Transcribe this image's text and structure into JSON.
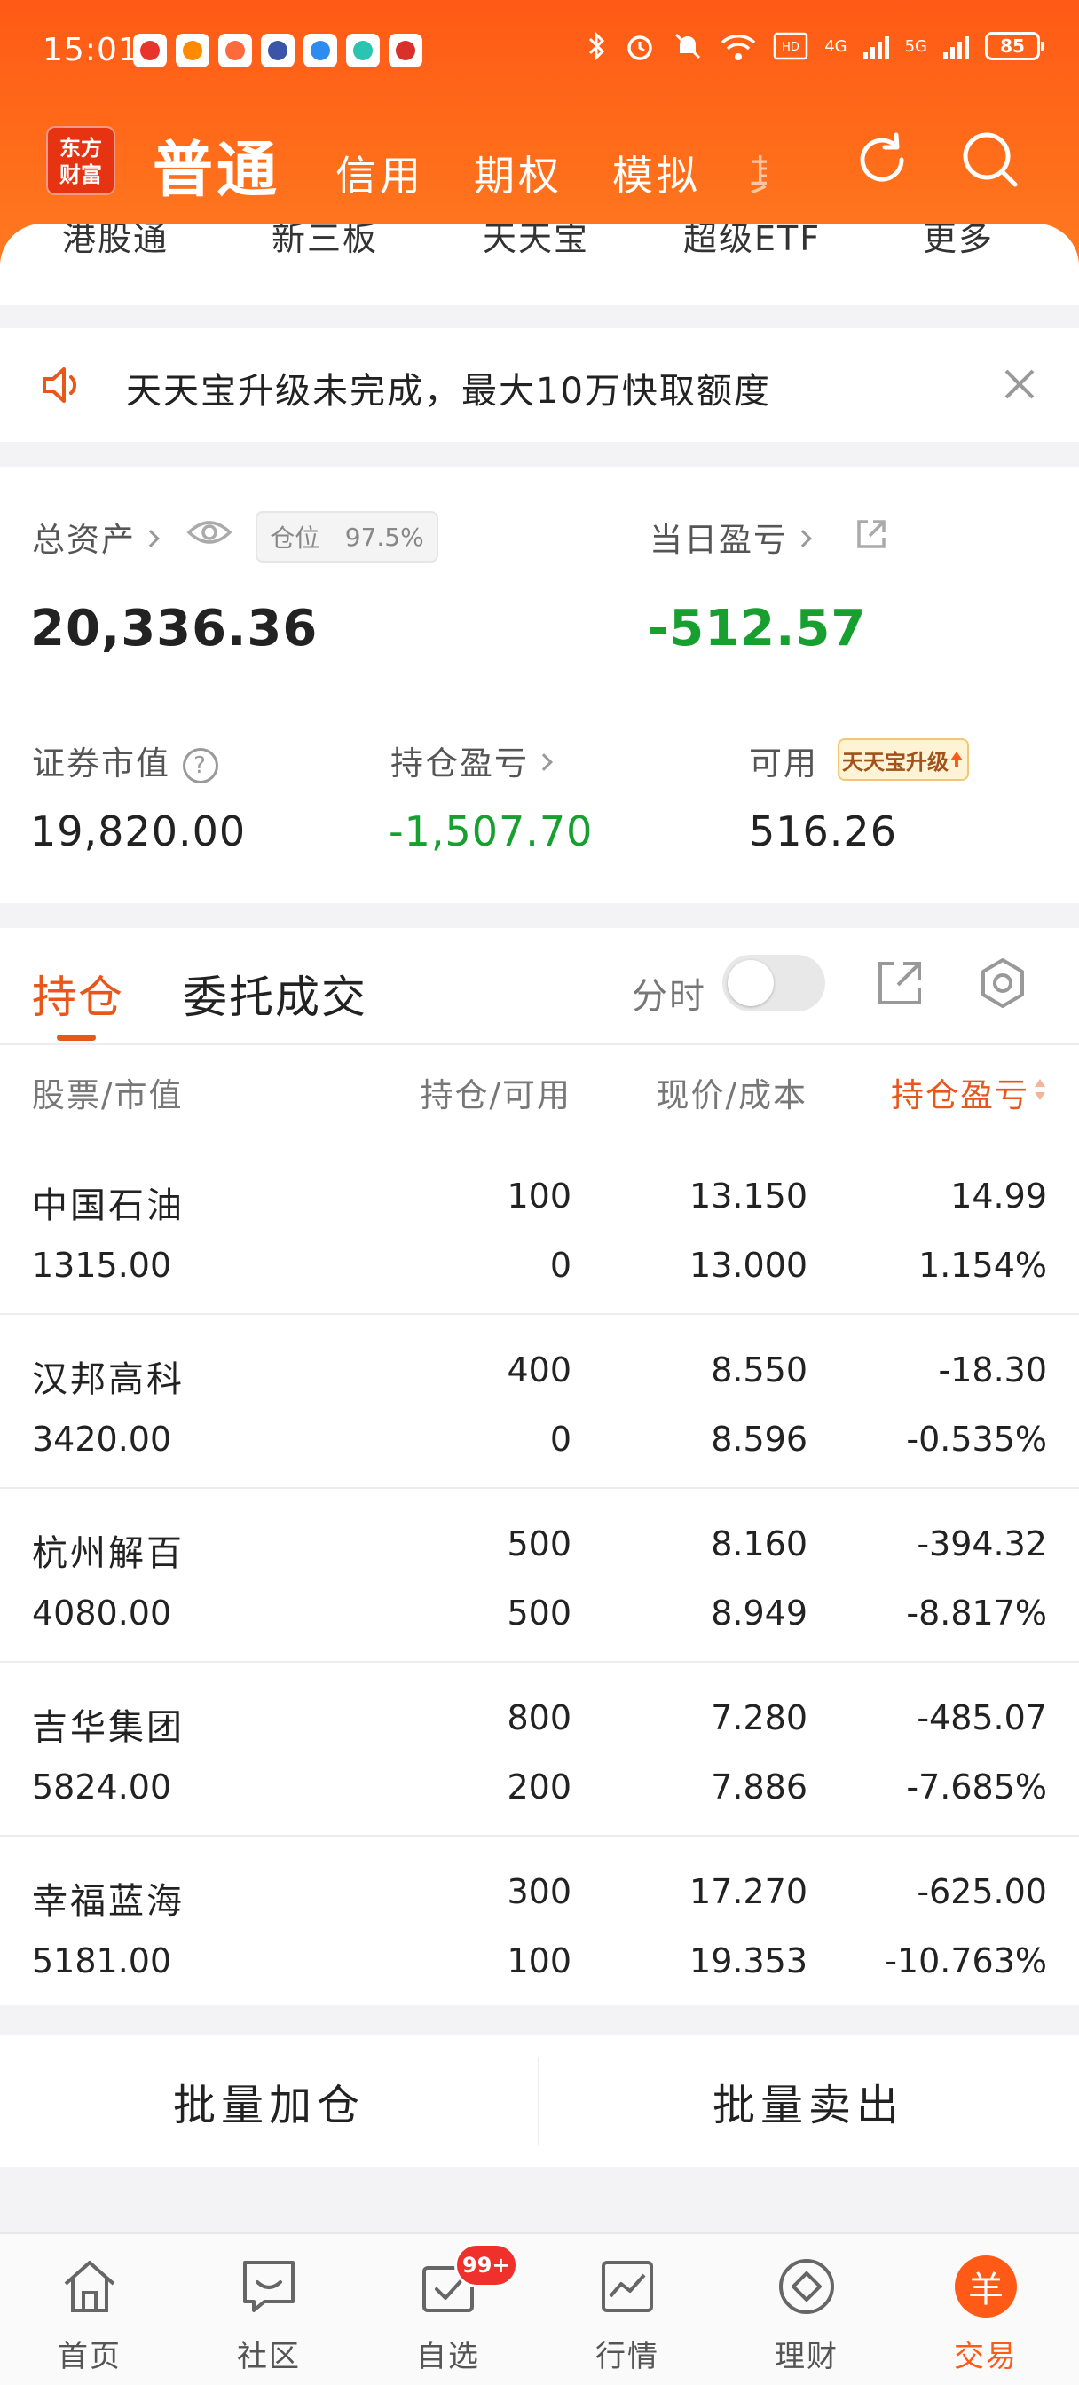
{
  "status_bar": {
    "time": "15:01",
    "net_4g": "4G",
    "net_5g": "5G",
    "battery": "85"
  },
  "header": {
    "logo_line1": "东方",
    "logo_line2": "财富",
    "tabs": [
      "普通",
      "信用",
      "期权",
      "模拟",
      "其"
    ]
  },
  "quick_entries": [
    "港股通",
    "新三板",
    "天天宝",
    "超级ETF",
    "更多"
  ],
  "notice": {
    "text": "天天宝升级未完成，最大10万快取额度"
  },
  "assets": {
    "total_label": "总资产",
    "position_label": "仓位",
    "position_value": "97.5%",
    "total_value": "20,336.36",
    "daily_pl_label": "当日盈亏",
    "daily_pl_value": "-512.57",
    "market_value_label": "证券市值",
    "market_value": "19,820.00",
    "holding_pl_label": "持仓盈亏",
    "holding_pl_value": "-1,507.70",
    "available_label": "可用",
    "available_value": "516.26",
    "upgrade_badge": "天天宝升级"
  },
  "holdings": {
    "tab_holdings": "持仓",
    "tab_orders": "委托成交",
    "timeshare_label": "分时",
    "columns": [
      "股票/市值",
      "持仓/可用",
      "现价/成本",
      "持仓盈亏"
    ],
    "rows": [
      {
        "name": "中国石油",
        "market_value": "1315.00",
        "qty": "100",
        "available": "0",
        "price": "13.150",
        "cost": "13.000",
        "pl": "14.99",
        "pl_pct": "1.154%",
        "up": true
      },
      {
        "name": "汉邦高科",
        "market_value": "3420.00",
        "qty": "400",
        "available": "0",
        "price": "8.550",
        "cost": "8.596",
        "pl": "-18.30",
        "pl_pct": "-0.535%",
        "up": false
      },
      {
        "name": "杭州解百",
        "market_value": "4080.00",
        "qty": "500",
        "available": "500",
        "price": "8.160",
        "cost": "8.949",
        "pl": "-394.32",
        "pl_pct": "-8.817%",
        "up": false
      },
      {
        "name": "吉华集团",
        "market_value": "5824.00",
        "qty": "800",
        "available": "200",
        "price": "7.280",
        "cost": "7.886",
        "pl": "-485.07",
        "pl_pct": "-7.685%",
        "up": false
      },
      {
        "name": "幸福蓝海",
        "market_value": "5181.00",
        "qty": "300",
        "available": "100",
        "price": "17.270",
        "cost": "19.353",
        "pl": "-625.00",
        "pl_pct": "-10.763%",
        "up": false
      }
    ]
  },
  "batch": {
    "add_label": "批量加仓",
    "sell_label": "批量卖出"
  },
  "bottom_nav": {
    "items": [
      "首页",
      "社区",
      "自选",
      "行情",
      "理财",
      "交易"
    ],
    "watchlist_badge": "99+",
    "trade_glyph": "羊"
  },
  "colors": {
    "brand_orange": "#ff5a16",
    "accent_orange": "#e8561a",
    "gain_red": "#e02b2b",
    "loss_green": "#17a02f"
  },
  "icons": [
    "refresh-icon",
    "search-icon",
    "speaker-icon",
    "close-icon",
    "eye-icon",
    "external-link-icon",
    "help-icon",
    "share-icon",
    "settings-icon",
    "home-icon",
    "community-icon",
    "watchlist-icon",
    "market-icon",
    "wealth-icon",
    "trade-icon"
  ]
}
